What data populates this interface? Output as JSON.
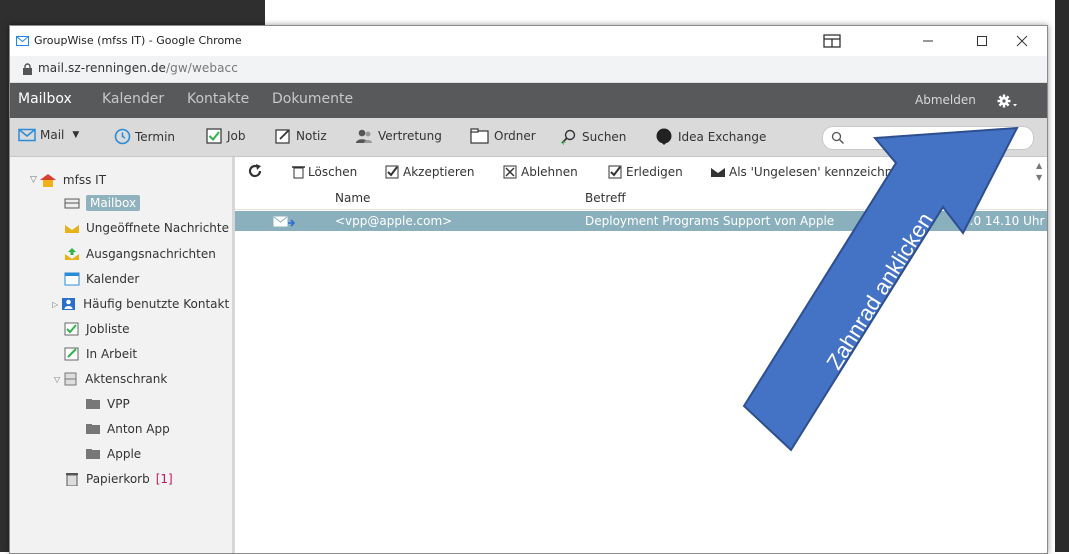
{
  "window": {
    "title": "GroupWise (mfss IT) - Google Chrome",
    "url_host": "mail.sz-renningen.de",
    "url_path": "/gw/webacc"
  },
  "nav": {
    "items": [
      "Mailbox",
      "Kalender",
      "Kontakte",
      "Dokumente"
    ],
    "logout": "Abmelden"
  },
  "toolbar": {
    "mail": "Mail",
    "termin": "Termin",
    "job": "Job",
    "notiz": "Notiz",
    "vertretung": "Vertretung",
    "ordner": "Ordner",
    "suchen": "Suchen",
    "idea": "Idea Exchange",
    "search_value": ""
  },
  "sidebar": {
    "root": "mfss IT",
    "items": [
      {
        "label": "Mailbox",
        "icon": "mailbox-icon"
      },
      {
        "label": "Ungeöffnete Nachrichte",
        "icon": "envelope-icon"
      },
      {
        "label": "Ausgangsnachrichten",
        "icon": "outbox-icon"
      },
      {
        "label": "Kalender",
        "icon": "calendar-icon"
      },
      {
        "label": "Häufig benutzte Kontakt",
        "icon": "contacts-icon"
      },
      {
        "label": "Jobliste",
        "icon": "checklist-icon"
      },
      {
        "label": "In Arbeit",
        "icon": "draft-icon"
      },
      {
        "label": "Aktenschrank",
        "icon": "cabinet-icon"
      },
      {
        "label": "VPP",
        "icon": "folder-icon"
      },
      {
        "label": "Anton App",
        "icon": "folder-icon"
      },
      {
        "label": "Apple",
        "icon": "folder-icon"
      },
      {
        "label": "Papierkorb",
        "icon": "trash-icon",
        "badge": "[1]"
      }
    ]
  },
  "actions": {
    "loeschen": "Löschen",
    "akzeptieren": "Akzeptieren",
    "ablehnen": "Ablehnen",
    "erledigen": "Erledigen",
    "ungelesen": "Als 'Ungelesen' kennzeichnen"
  },
  "columns": {
    "name": "Name",
    "betreff": "Betreff"
  },
  "messages": [
    {
      "name": "<vpp@apple.com>",
      "subject": "Deployment Programs Support von Apple",
      "date": "2.0 14.10 Uhr"
    }
  ],
  "annotation": {
    "text": "Zahnrad anklicken",
    "color": "#4472c4"
  },
  "colors": {
    "navbar": "#58595b",
    "selected_row": "#8ab0bd",
    "toolbar": "#dadada"
  }
}
